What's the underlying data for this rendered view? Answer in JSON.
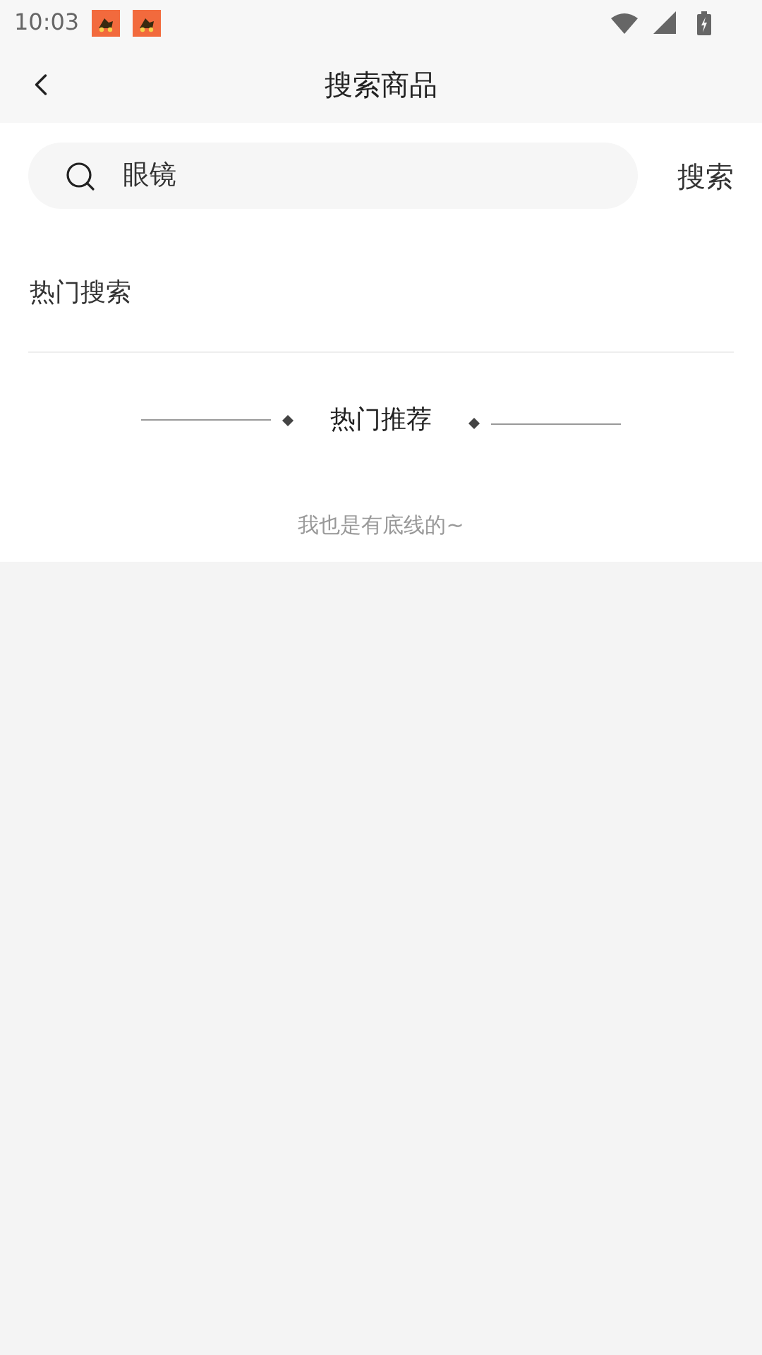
{
  "status_bar": {
    "time": "10:03",
    "notifications": [
      {
        "kind": "app"
      },
      {
        "kind": "app"
      }
    ]
  },
  "header": {
    "title": "搜索商品"
  },
  "search": {
    "value": "眼镜",
    "button": "搜索"
  },
  "hot_search": {
    "title": "热门搜索"
  },
  "recommend": {
    "title": "热门推荐"
  },
  "footer": {
    "text": "我也是有底线的~"
  }
}
